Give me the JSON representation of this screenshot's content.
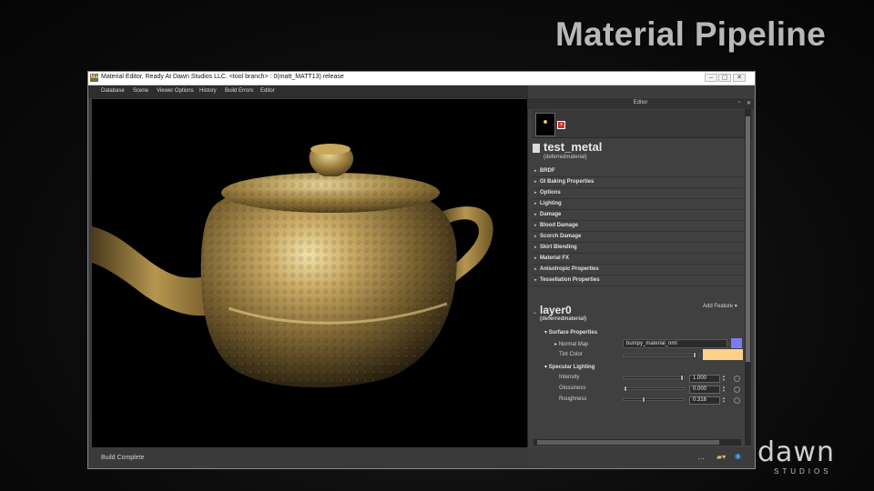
{
  "slide": {
    "title": "Material Pipeline"
  },
  "window": {
    "app_icon": "Ma",
    "title": "Material Editor, Ready At Dawn Studios LLC. <tool branch> : 0(matt_MATT13) release",
    "controls": {
      "minimize": "–",
      "maximize": "▢",
      "close": "✕"
    }
  },
  "menu": [
    "Database",
    "Scene",
    "Viewer Options",
    "History",
    "Build Errors",
    "Editor"
  ],
  "status": {
    "text": "Build Complete"
  },
  "editor": {
    "panel_title": "Editor",
    "material": {
      "name": "test_metal",
      "type": "(deferredmaterial)"
    },
    "sections": [
      "BRDF",
      "GI Baking Properties",
      "Options",
      "Lighting",
      "Damage",
      "Blood Damage",
      "Scorch Damage",
      "Skirt Blending",
      "Material FX",
      "Anisotropic Properties",
      "Tessellation Properties"
    ],
    "add_feature": "Add Feature ▾",
    "layer": {
      "name": "layer0",
      "type": "(deferredmaterial)"
    },
    "surface_properties": {
      "label": "Surface Properties",
      "normal_map_label": "Normal Map",
      "normal_map_value": "bumpy_material_nml",
      "normal_map_color": "#7b7bf0",
      "tint_label": "Tint Color",
      "tint_color": "#ffd089"
    },
    "specular": {
      "label": "Specular Lighting",
      "params": [
        {
          "name": "Intensity",
          "value": "1.000",
          "level": 1.0
        },
        {
          "name": "Glossiness",
          "value": "0.000",
          "level": 0.0
        },
        {
          "name": "Roughness",
          "value": "0.316",
          "level": 0.316
        }
      ]
    }
  },
  "logo": {
    "main": "dawn",
    "sub": "STUDIOS"
  }
}
